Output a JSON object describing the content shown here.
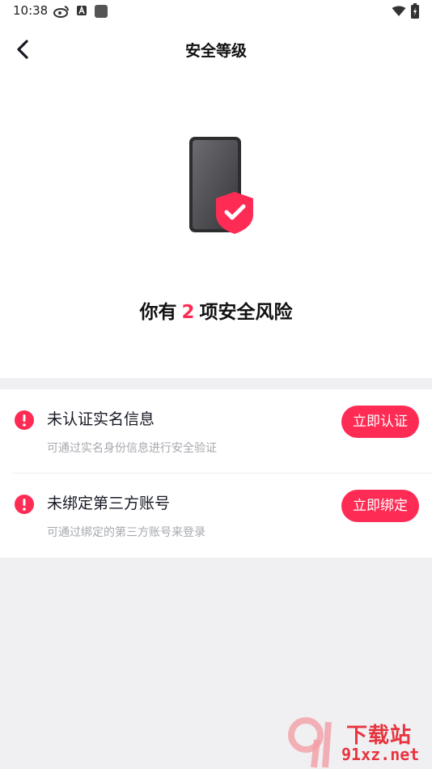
{
  "status_bar": {
    "time": "10:38",
    "left_icons": [
      "weibo-icon",
      "notification-a-icon",
      "app-square-icon"
    ],
    "right_icons": [
      "wifi-icon",
      "battery-charging-icon"
    ]
  },
  "header": {
    "title": "安全等级"
  },
  "hero": {
    "icon": "phone-shield-check-icon"
  },
  "summary": {
    "prefix": "你有",
    "count": "2",
    "suffix": "项安全风险"
  },
  "items": [
    {
      "title": "未认证实名信息",
      "description": "可通过实名身份信息进行安全验证",
      "button": "立即认证"
    },
    {
      "title": "未绑定第三方账号",
      "description": "可通过绑定的第三方账号来登录",
      "button": "立即绑定"
    }
  ],
  "watermark": {
    "text": "下载站",
    "url": "91xz.net"
  },
  "colors": {
    "accent": "#fe2c55",
    "background": "#f0f0f2"
  }
}
